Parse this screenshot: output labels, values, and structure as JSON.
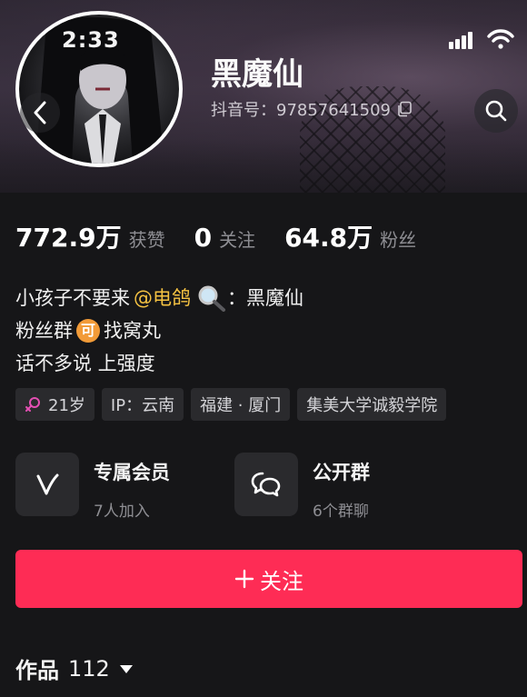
{
  "status_bar": {
    "time": "2:33"
  },
  "profile": {
    "name": "黑魔仙",
    "id_label": "抖音号：97857641509"
  },
  "stats": [
    {
      "value": "772.9万",
      "label": "获赞"
    },
    {
      "value": "0",
      "label": "关注"
    },
    {
      "value": "64.8万",
      "label": "粉丝"
    }
  ],
  "bio": {
    "line1_prefix": "小孩子不要来",
    "line1_mention": "@电鸽",
    "line1_suffix": "：黑魔仙",
    "line2_prefix": "粉丝群",
    "line2_badge": "可",
    "line2_suffix": "找窝丸",
    "line3": "话不多说 上强度"
  },
  "tags": {
    "age": "21岁",
    "ip": "IP：云南",
    "location": "福建 · 厦门",
    "school": "集美大学诚毅学院"
  },
  "cards": {
    "membership": {
      "title": "专属会员",
      "subtitle": "7人加入"
    },
    "group": {
      "title": "公开群",
      "subtitle": "6个群聊"
    }
  },
  "follow_button": {
    "label": "关注"
  },
  "works": {
    "label": "作品",
    "count": "112"
  },
  "colors": {
    "accent": "#fe2c55",
    "mention": "#f5c242",
    "badge": "#f29b38",
    "female_icon": "#e44fb3"
  }
}
